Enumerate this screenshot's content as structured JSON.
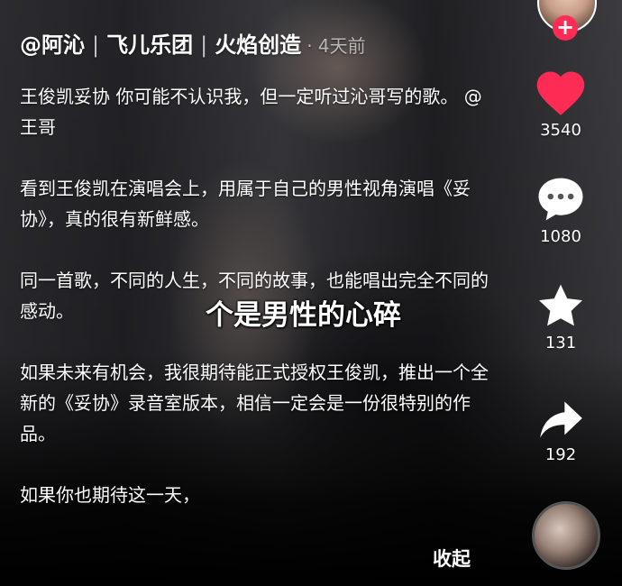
{
  "header": {
    "author": "@阿沁",
    "separator": "|",
    "tag1": "飞儿乐团",
    "tag2": "火焰创造",
    "time": "· 4天前"
  },
  "caption": {
    "paragraphs": [
      "王俊凯妥协 你可能不认识我，但一定听过沁哥写的歌。 @王哥",
      "看到王俊凯在演唱会上，用属于自己的男性视角演唱《妥协》，真的很有新鲜感。",
      "同一首歌，不同的人生，不同的故事，也能唱出完全不同的感动。",
      "如果未来有机会，我很期待能正式授权王俊凯，推出一个全新的《妥协》录音室版本，相信一定会是一份很特别的作品。",
      "如果你也期待这一天，"
    ]
  },
  "video_subtitle": "个是男性的心碎",
  "collapse_label": "收起",
  "side": {
    "follow_symbol": "+",
    "like_count": "3540",
    "comment_count": "1080",
    "favorite_count": "131",
    "share_count": "192",
    "icons": [
      "heart-icon",
      "comment-icon",
      "star-icon",
      "share-icon"
    ]
  },
  "colors": {
    "like": "#fe2c55",
    "follow": "#fe2c55",
    "text": "#ffffff"
  }
}
